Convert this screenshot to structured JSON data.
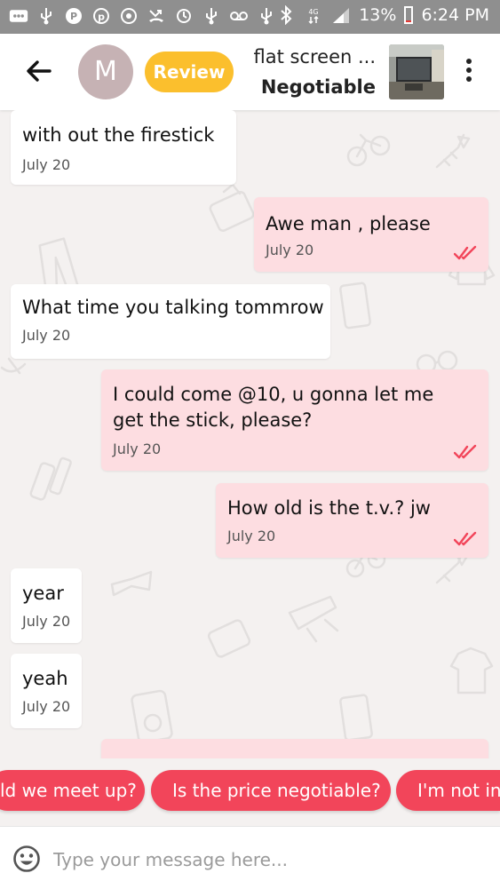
{
  "status_bar": {
    "battery": "13%",
    "time": "6:24 PM"
  },
  "header": {
    "avatar_letter": "M",
    "review_label": "Review",
    "item_title": "flat screen ...",
    "item_price": "Negotiable"
  },
  "messages": [
    {
      "text": "with out the firestick",
      "time": "July 20",
      "dir": "in"
    },
    {
      "text": "Awe man , please",
      "time": "July 20",
      "dir": "out"
    },
    {
      "text": "What time you talking tommrow",
      "time": "July 20",
      "dir": "in"
    },
    {
      "text": "I could come @10, u gonna let me\nget the stick, please?",
      "time": "July 20",
      "dir": "out"
    },
    {
      "text": "How old is the t.v.? jw",
      "time": "July 20",
      "dir": "out"
    },
    {
      "text": "year",
      "time": "July 20",
      "dir": "in"
    },
    {
      "text": "yeah",
      "time": "July 20",
      "dir": "in"
    }
  ],
  "quick_replies": [
    "ld we meet up?",
    "Is the price negotiable?",
    "I'm not int"
  ],
  "composer": {
    "placeholder": "Type your message here..."
  },
  "colors": {
    "review": "#fbbf2d",
    "outgoing_bubble": "#fddde1",
    "quick_reply": "#f2455a",
    "read_tick": "#f2455a"
  }
}
